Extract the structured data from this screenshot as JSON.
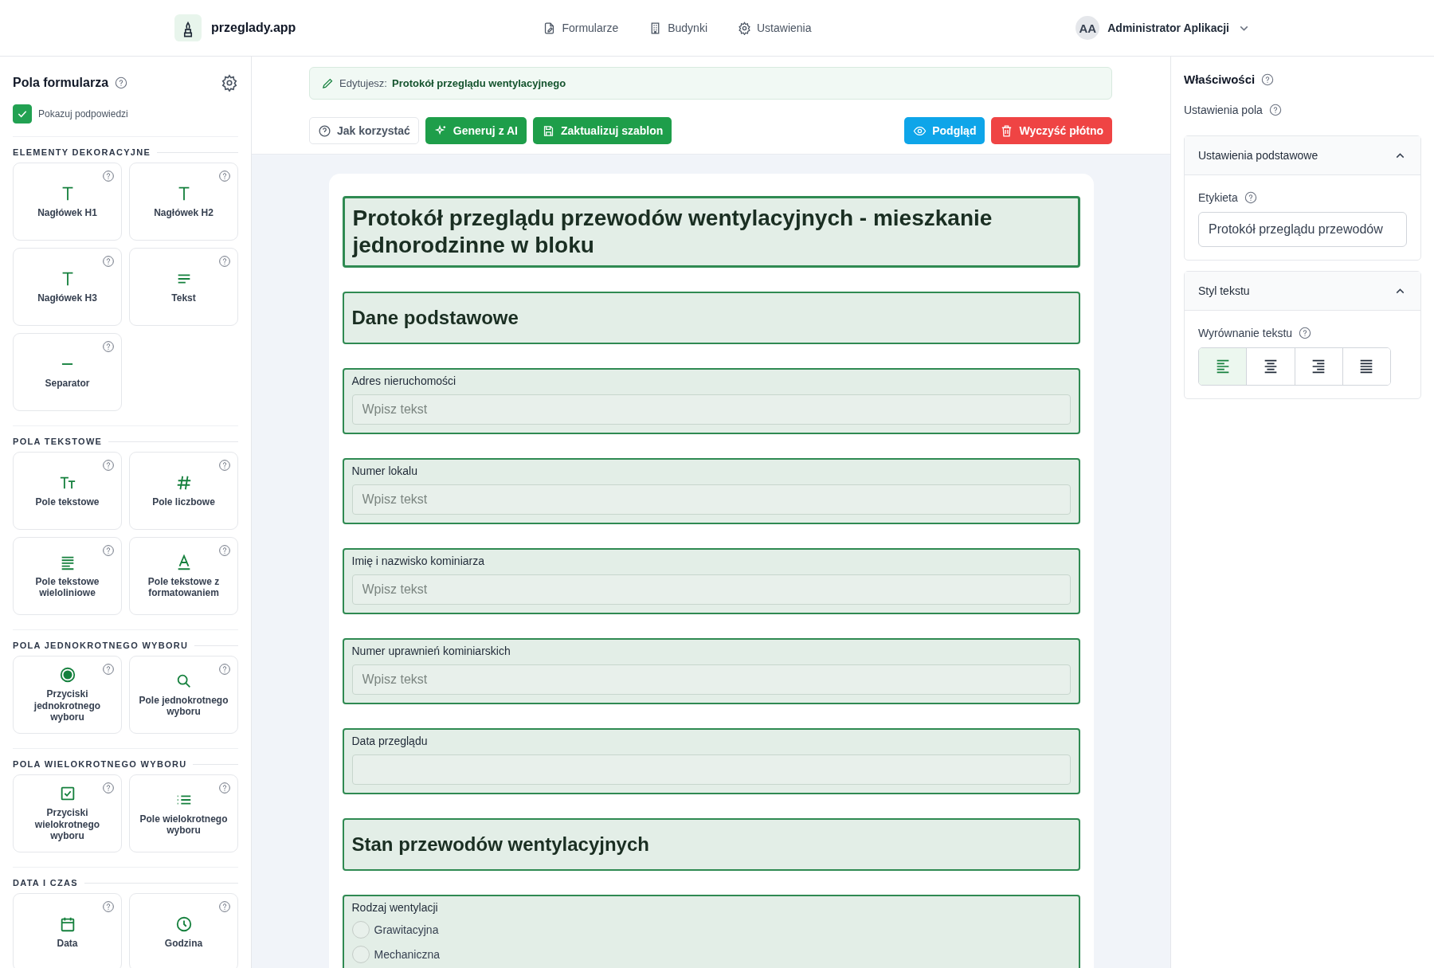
{
  "header": {
    "app_name": "przeglady.app",
    "nav": [
      {
        "kind": "forms",
        "label": "Formularze"
      },
      {
        "kind": "buildings",
        "label": "Budynki"
      },
      {
        "kind": "settings",
        "label": "Ustawienia"
      }
    ],
    "user": {
      "initials": "AA",
      "name": "Administrator Aplikacji"
    }
  },
  "sidebar": {
    "title": "Pola formularza",
    "show_hints": {
      "label": "Pokazuj podpowiedzi",
      "checked": true
    },
    "sections": [
      {
        "title": "ELEMENTY DEKORACYJNE",
        "items": [
          {
            "kind": "h1",
            "label": "Nagłówek H1"
          },
          {
            "kind": "h2",
            "label": "Nagłówek H2"
          },
          {
            "kind": "h3",
            "label": "Nagłówek H3"
          },
          {
            "kind": "text",
            "label": "Tekst"
          },
          {
            "kind": "separator",
            "label": "Separator"
          }
        ]
      },
      {
        "title": "POLA TEKSTOWE",
        "items": [
          {
            "kind": "textfield",
            "label": "Pole tekstowe"
          },
          {
            "kind": "number",
            "label": "Pole liczbowe"
          },
          {
            "kind": "textarea",
            "label": "Pole tekstowe wieloliniowe"
          },
          {
            "kind": "richtext",
            "label": "Pole tekstowe z formatowaniem"
          }
        ]
      },
      {
        "title": "POLA JEDNOKROTNEGO WYBORU",
        "items": [
          {
            "kind": "radio",
            "label": "Przyciski jednokrotnego wyboru"
          },
          {
            "kind": "select",
            "label": "Pole jednokrotnego wyboru"
          }
        ]
      },
      {
        "title": "POLA WIELOKROTNEGO WYBORU",
        "items": [
          {
            "kind": "checkboxes",
            "label": "Przyciski wielokrotnego wyboru"
          },
          {
            "kind": "multiselect",
            "label": "Pole wielokrotnego wyboru"
          }
        ]
      },
      {
        "title": "DATA I CZAS",
        "items": [
          {
            "kind": "date",
            "label": "Data"
          },
          {
            "kind": "time",
            "label": "Godzina"
          }
        ]
      }
    ]
  },
  "editor": {
    "banner": {
      "prefix": "Edytujesz:",
      "name": "Protokół przeglądu wentylacyjnego"
    },
    "toolbar": [
      {
        "kind": "help",
        "label": "Jak korzystać"
      },
      {
        "kind": "ai",
        "label": "Generuj z AI"
      },
      {
        "kind": "save",
        "label": "Zaktualizuj szablon"
      },
      {
        "kind": "preview",
        "label": "Podgląd"
      },
      {
        "kind": "clear",
        "label": "Wyczyść płótno"
      }
    ],
    "elements": [
      {
        "kind": "h1",
        "text": "Protokół przeglądu przewodów wentylacyjnych - mieszkanie jednorodzinne w bloku",
        "selected": true
      },
      {
        "kind": "h2",
        "text": "Dane podstawowe",
        "selected": false
      },
      {
        "kind": "input",
        "label": "Adres nieruchomości",
        "placeholder": "Wpisz tekst",
        "selected": false
      },
      {
        "kind": "input",
        "label": "Numer lokalu",
        "placeholder": "Wpisz tekst",
        "selected": false
      },
      {
        "kind": "input",
        "label": "Imię i nazwisko kominiarza",
        "placeholder": "Wpisz tekst",
        "selected": false
      },
      {
        "kind": "input",
        "label": "Numer uprawnień kominiarskich",
        "placeholder": "Wpisz tekst",
        "selected": false
      },
      {
        "kind": "input",
        "label": "Data przeglądu",
        "selected": false
      },
      {
        "kind": "h2",
        "text": "Stan przewodów wentylacyjnych",
        "selected": false
      },
      {
        "kind": "radio",
        "label": "Rodzaj wentylacji",
        "options": [
          {
            "label": "Grawitacyjna",
            "selected": false
          },
          {
            "label": "Mechaniczna",
            "selected": false
          }
        ],
        "selected": false
      }
    ]
  },
  "properties": {
    "title": "Właściwości",
    "subtitle": "Ustawienia pola",
    "basic": {
      "title": "Ustawienia podstawowe",
      "expanded": true,
      "label_title": "Etykieta",
      "label_value": "Protokół przeglądu przewodów"
    },
    "style": {
      "title": "Styl tekstu",
      "expanded": true,
      "align_title": "Wyrównanie tekstu",
      "align": [
        {
          "kind": "left",
          "selected": true
        },
        {
          "kind": "center",
          "selected": false
        },
        {
          "kind": "right",
          "selected": false
        },
        {
          "kind": "justify",
          "selected": false
        }
      ]
    }
  }
}
